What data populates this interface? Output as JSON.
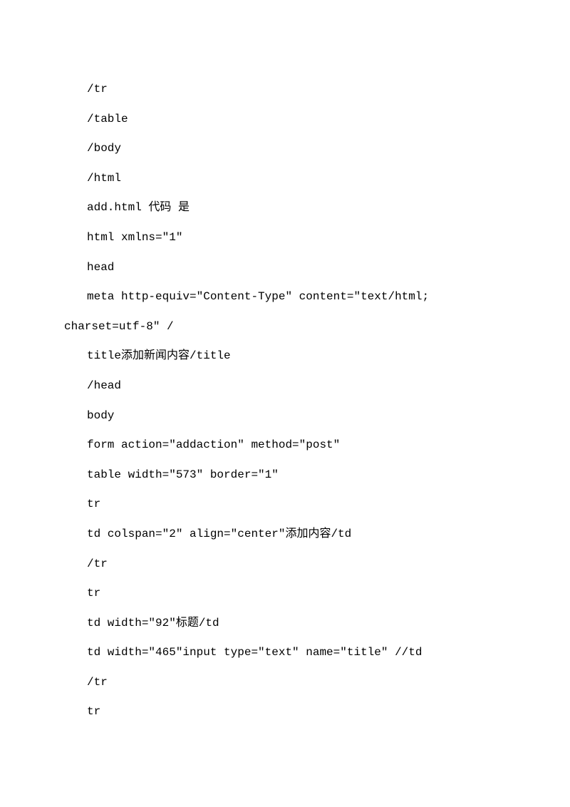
{
  "lines": [
    "/tr",
    "/table",
    "/body",
    "/html",
    "add.html 代码 是",
    "html xmlns=\"1\"",
    "head",
    "meta http-equiv=\"Content-Type\" content=\"text/html;",
    "charset=utf-8\" /",
    "title添加新闻内容/title",
    "/head",
    "body",
    "form action=\"addaction\" method=\"post\"",
    "table width=\"573\" border=\"1\"",
    "tr",
    "td colspan=\"2\" align=\"center\"添加内容/td",
    "/tr",
    "tr",
    "td width=\"92\"标题/td",
    "td width=\"465\"input type=\"text\" name=\"title\" //td",
    "/tr",
    "tr"
  ]
}
